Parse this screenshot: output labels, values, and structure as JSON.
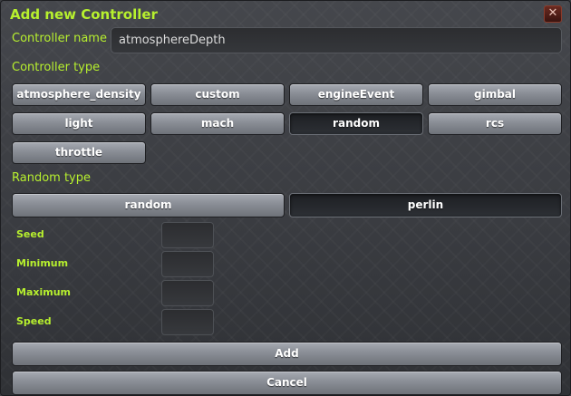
{
  "window": {
    "title": "Add new Controller",
    "close_label": "✕"
  },
  "controller_name": {
    "label": "Controller name",
    "value": "atmosphereDepth"
  },
  "controller_type": {
    "label": "Controller type",
    "options": [
      "atmosphere_density",
      "custom",
      "engineEvent",
      "gimbal",
      "light",
      "mach",
      "random",
      "rcs",
      "throttle"
    ],
    "selected": "random"
  },
  "random_type": {
    "label": "Random type",
    "options": [
      "random",
      "perlin"
    ],
    "selected": "perlin"
  },
  "fields": {
    "seed_label": "Seed",
    "minimum_label": "Minimum",
    "maximum_label": "Maximum",
    "speed_label": "Speed"
  },
  "actions": {
    "add_label": "Add",
    "cancel_label": "Cancel"
  },
  "colors": {
    "accent": "#b7f02e",
    "panel": "#3c3e42"
  }
}
